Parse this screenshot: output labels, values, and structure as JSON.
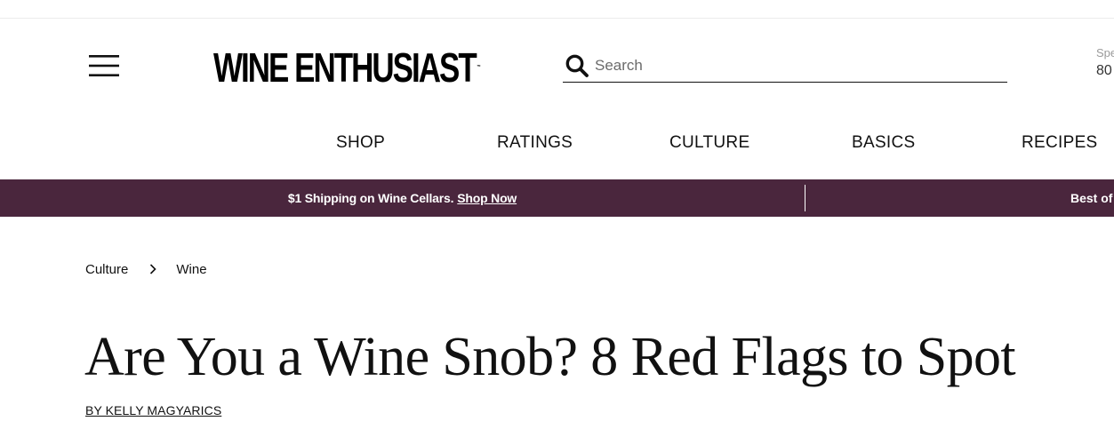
{
  "header": {
    "logo_text": "WINE ENTHUSIAST",
    "logo_tm": "™",
    "search_placeholder": "Search",
    "peek_label": "Spe",
    "peek_value": "80"
  },
  "nav": {
    "items": [
      {
        "label": "SHOP"
      },
      {
        "label": "RATINGS"
      },
      {
        "label": "CULTURE"
      },
      {
        "label": "BASICS"
      },
      {
        "label": "RECIPES"
      }
    ]
  },
  "promo": {
    "text": "$1 Shipping on Wine Cellars.",
    "link": "Shop Now",
    "next_text": "Best of",
    "background": "#4a263d"
  },
  "breadcrumb": {
    "items": [
      {
        "label": "Culture"
      },
      {
        "label": "Wine"
      }
    ],
    "separator_icon": "chevron-right-icon"
  },
  "article": {
    "title": "Are You a Wine Snob? 8 Red Flags to Spot",
    "byline": "BY KELLY MAGYARICS"
  },
  "icons": {
    "menu": "hamburger-menu-icon",
    "search": "search-icon"
  }
}
